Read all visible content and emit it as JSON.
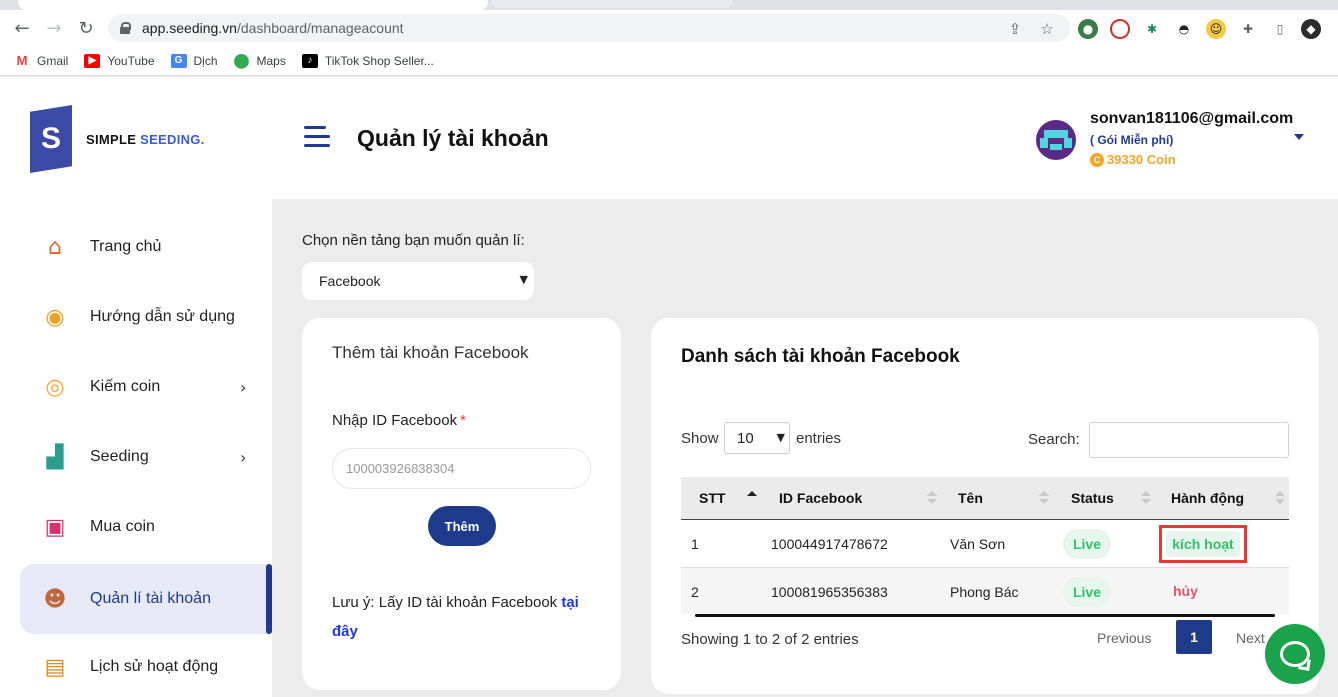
{
  "browser": {
    "url_host": "app.seeding.vn",
    "url_path": "/dashboard/manageacount",
    "bookmarks": [
      {
        "label": "Gmail",
        "color": "#ea4335"
      },
      {
        "label": "YouTube",
        "color": "#ff0000"
      },
      {
        "label": "Dịch",
        "color": "#4285f4"
      },
      {
        "label": "Maps",
        "color": "#34a853"
      },
      {
        "label": "TikTok Shop Seller...",
        "color": "#000000"
      }
    ]
  },
  "sidebar": {
    "logo_letter": "S",
    "logo_text_a": "SIMPLE ",
    "logo_text_b": "SEEDING.",
    "items": [
      {
        "label": "Trang chủ",
        "icon": "home-icon"
      },
      {
        "label": "Hướng dẫn sử dụng",
        "icon": "book-icon"
      },
      {
        "label": "Kiếm coin",
        "icon": "coins-icon"
      },
      {
        "label": "Seeding",
        "icon": "chart-icon"
      },
      {
        "label": "Mua coin",
        "icon": "shopping-bag-icon"
      },
      {
        "label": "Quản lí tài khoản",
        "icon": "users-icon"
      },
      {
        "label": "Lịch sử hoạt động",
        "icon": "scroll-icon"
      }
    ]
  },
  "header": {
    "title": "Quản lý tài khoản",
    "user_email": "sonvan181106@gmail.com",
    "user_plan": "( Gói Miễn phí)",
    "user_coin": "39330 Coin"
  },
  "main": {
    "platform_label": "Chọn nền tảng bạn muốn quản lí:",
    "platform_selected": "Facebook"
  },
  "add_card": {
    "title": "Thêm tài khoản Facebook",
    "field_label": "Nhập ID Facebook",
    "required_mark": "*",
    "placeholder": "100003926838304",
    "button": "Thêm",
    "note_text": "Lưu ý: Lấy ID tài khoản Facebook ",
    "note_link": "tại đây"
  },
  "list_card": {
    "title": "Danh sách tài khoản Facebook",
    "show_label": "Show",
    "entries_value": "10",
    "entries_label": "entries",
    "search_label": "Search:",
    "columns": [
      "STT",
      "ID Facebook",
      "Tên",
      "Status",
      "Hành động"
    ],
    "rows": [
      {
        "stt": "1",
        "id": "100044917478672",
        "name": "Văn Sơn",
        "status": "Live",
        "action": "kích hoạt"
      },
      {
        "stt": "2",
        "id": "100081965356383",
        "name": "Phong Bác",
        "status": "Live",
        "action": "hủy"
      }
    ],
    "showing": "Showing 1 to 2 of 2 entries",
    "prev": "Previous",
    "page": "1",
    "next": "Next"
  },
  "colors": {
    "brand": "#1e3a8a",
    "live": "#32c26a",
    "cancel": "#e8506e",
    "highlight": "#e53935",
    "coin": "#f5a623"
  }
}
